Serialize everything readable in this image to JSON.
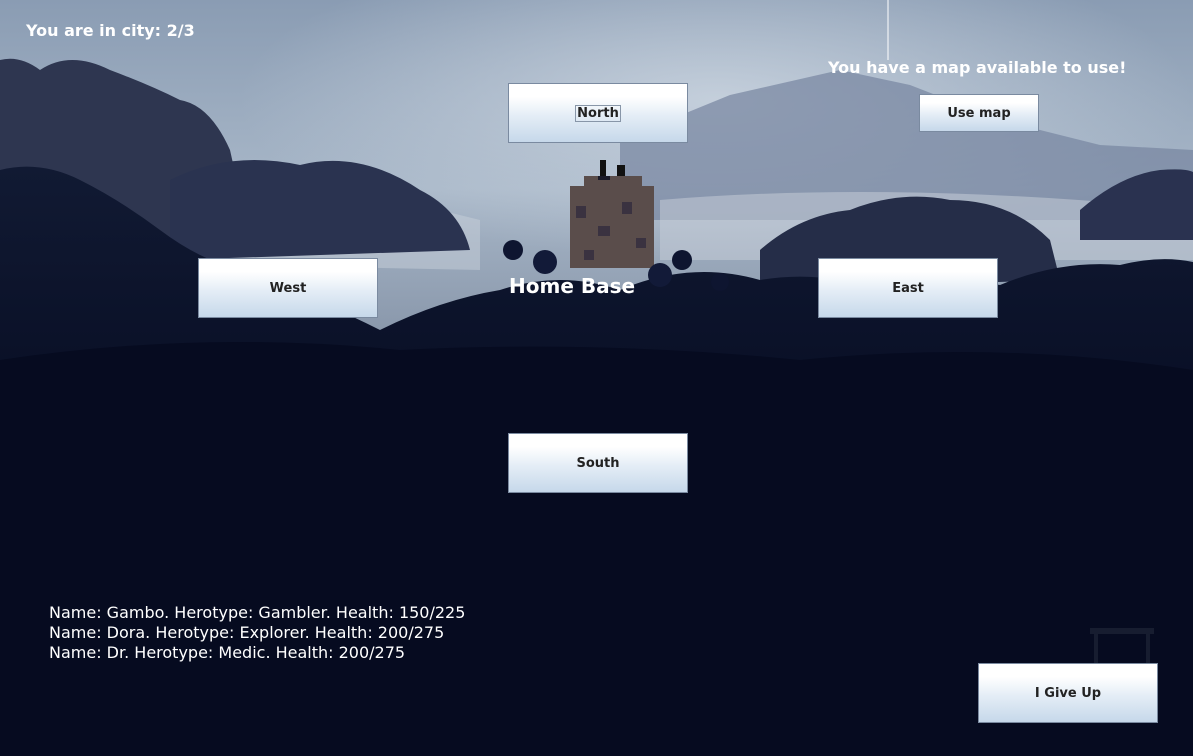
{
  "status": {
    "city": "You are in city: 2/3",
    "map_message": "You have a map available to use!",
    "location": "Home Base"
  },
  "buttons": {
    "north": "North",
    "south": "South",
    "east": "East",
    "west": "West",
    "use_map": "Use map",
    "give_up": "I Give Up"
  },
  "party": [
    "Name: Gambo. Herotype: Gambler. Health: 150/225",
    "Name: Dora. Herotype: Explorer. Health: 200/275",
    "Name: Dr. Herotype: Medic. Health: 200/275"
  ],
  "colors": {
    "sky_top": "#8a9cb3",
    "night": "#050a1f",
    "button_top": "#ffffff",
    "button_bottom": "#c6d8ea"
  }
}
